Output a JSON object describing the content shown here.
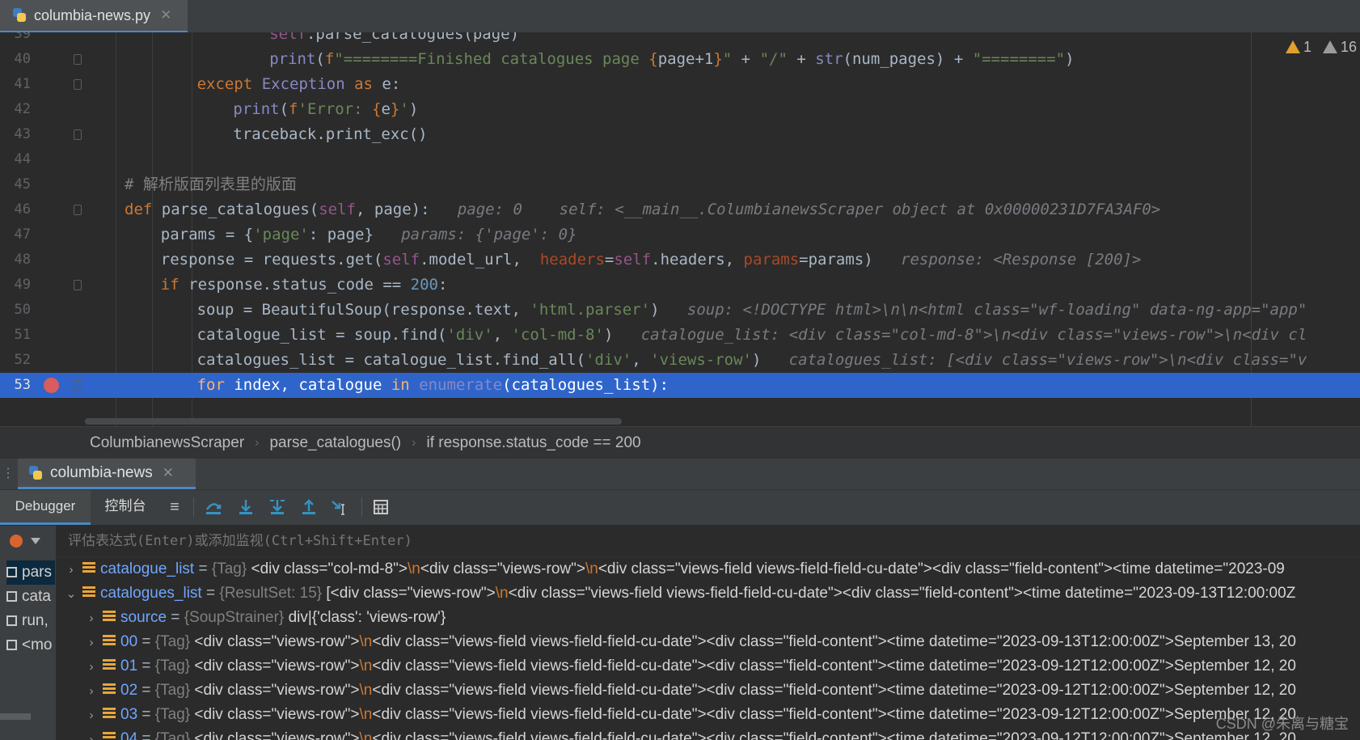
{
  "file_tab": {
    "name": "columbia-news.py",
    "close": "✕"
  },
  "inspections": {
    "warnings": "1",
    "weak_warnings": "16"
  },
  "editor": {
    "lines": [
      {
        "num": "39",
        "text": "self.parse_catalogues(page)",
        "indent": 8
      },
      {
        "num": "40",
        "text": "print(f\"========Finished catalogues page {page+1}\" + \"/\" + str(num_pages) + \"========\")",
        "indent": 8
      },
      {
        "num": "41",
        "text": "except Exception as e:",
        "indent": 4
      },
      {
        "num": "42",
        "text": "print(f'Error: {e}')",
        "indent": 6
      },
      {
        "num": "43",
        "text": "traceback.print_exc()",
        "indent": 6
      },
      {
        "num": "44",
        "text": "",
        "indent": 0
      },
      {
        "num": "45",
        "text": "# 解析版面列表里的版面",
        "indent": 0
      },
      {
        "num": "46",
        "text": "def parse_catalogues(self, page):",
        "indent": 0,
        "hint": "page: 0    self: <__main__.ColumbianewsScraper object at 0x00000231D7FA3AF0>"
      },
      {
        "num": "47",
        "text": "params = {'page': page}",
        "indent": 2,
        "hint": "params: {'page': 0}"
      },
      {
        "num": "48",
        "text": "response = requests.get(self.model_url,  headers=self.headers, params=params)",
        "indent": 2,
        "hint": "response: <Response [200]>"
      },
      {
        "num": "49",
        "text": "if response.status_code == 200:",
        "indent": 2
      },
      {
        "num": "50",
        "text": "soup = BeautifulSoup(response.text, 'html.parser')",
        "indent": 4,
        "hint": "soup: <!DOCTYPE html>\\n\\n<html class=\"wf-loading\" data-ng-app=\"app\""
      },
      {
        "num": "51",
        "text": "catalogue_list = soup.find('div', 'col-md-8')",
        "indent": 4,
        "hint": "catalogue_list: <div class=\"col-md-8\">\\n<div class=\"views-row\">\\n<div cl"
      },
      {
        "num": "52",
        "text": "catalogues_list = catalogue_list.find_all('div', 'views-row')",
        "indent": 4,
        "hint": "catalogues_list: [<div class=\"views-row\">\\n<div class=\"v"
      },
      {
        "num": "53",
        "text": "for index, catalogue in enumerate(catalogues_list):",
        "indent": 4,
        "current": true,
        "breakpoint": true
      }
    ]
  },
  "breadcrumb": [
    "ColumbianewsScraper",
    "parse_catalogues()",
    "if response.status_code == 200"
  ],
  "run_tab": {
    "name": "columbia-news",
    "close": "✕"
  },
  "debugger_tabs": {
    "debugger": "Debugger",
    "console": "控制台"
  },
  "eval_placeholder": "评估表达式(Enter)或添加监视(Ctrl+Shift+Enter)",
  "frames": [
    "pars",
    "cata",
    "run,",
    "<mo"
  ],
  "variables": [
    {
      "level": 0,
      "arrow": "›",
      "name": "catalogue_list",
      "type": "{Tag}",
      "value_parts": [
        "<div class=\"col-md-8\">",
        "\\n",
        "<div class=\"views-row\">",
        "\\n",
        "<div class=\"views-field views-field-field-cu-date\"><div class=\"field-content\"><time datetime=\"2023-09"
      ]
    },
    {
      "level": 0,
      "arrow": "⌄",
      "name": "catalogues_list",
      "type": "{ResultSet: 15}",
      "value_parts": [
        "[<div class=\"views-row\">",
        "\\n",
        "<div class=\"views-field views-field-field-cu-date\"><div class=\"field-content\"><time datetime=\"2023-09-13T12:00:00Z"
      ]
    },
    {
      "level": 1,
      "arrow": "›",
      "name": "source",
      "type": "{SoupStrainer}",
      "value_parts": [
        "div|{'class': 'views-row'}"
      ]
    },
    {
      "level": 1,
      "arrow": "›",
      "name": "00",
      "type": "{Tag}",
      "value_parts": [
        "<div class=\"views-row\">",
        "\\n",
        "<div class=\"views-field views-field-field-cu-date\"><div class=\"field-content\"><time datetime=\"2023-09-13T12:00:00Z\">September 13, 20"
      ]
    },
    {
      "level": 1,
      "arrow": "›",
      "name": "01",
      "type": "{Tag}",
      "value_parts": [
        "<div class=\"views-row\">",
        "\\n",
        "<div class=\"views-field views-field-field-cu-date\"><div class=\"field-content\"><time datetime=\"2023-09-12T12:00:00Z\">September 12, 20"
      ]
    },
    {
      "level": 1,
      "arrow": "›",
      "name": "02",
      "type": "{Tag}",
      "value_parts": [
        "<div class=\"views-row\">",
        "\\n",
        "<div class=\"views-field views-field-field-cu-date\"><div class=\"field-content\"><time datetime=\"2023-09-12T12:00:00Z\">September 12, 20"
      ]
    },
    {
      "level": 1,
      "arrow": "›",
      "name": "03",
      "type": "{Tag}",
      "value_parts": [
        "<div class=\"views-row\">",
        "\\n",
        "<div class=\"views-field views-field-field-cu-date\"><div class=\"field-content\"><time datetime=\"2023-09-12T12:00:00Z\">September 12, 20"
      ]
    },
    {
      "level": 1,
      "arrow": "›",
      "name": "04",
      "type": "{Tag}",
      "value_parts": [
        "<div class=\"views-row\">",
        "\\n",
        "<div class=\"views-field views-field-field-cu-date\"><div class=\"field-content\"><time datetime=\"2023-09-12T12:00:00Z\">September 12, 20"
      ]
    }
  ],
  "watermark": "CSDN @朱离与糖宝"
}
